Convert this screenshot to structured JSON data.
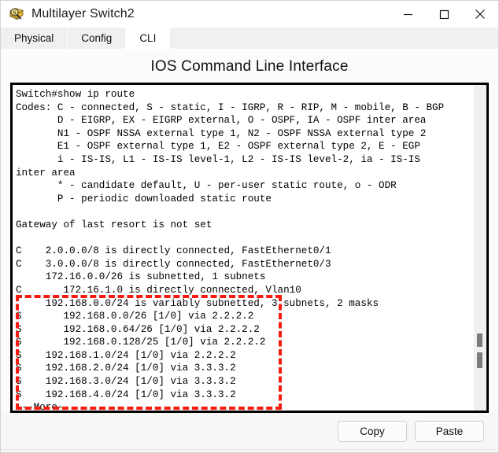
{
  "window": {
    "title": "Multilayer Switch2",
    "icon": "magnifier-over-package-icon",
    "controls": {
      "minimize": "minimize-icon",
      "maximize": "maximize-icon",
      "close": "close-icon"
    }
  },
  "tabs": [
    {
      "label": "Physical",
      "active": false
    },
    {
      "label": "Config",
      "active": false
    },
    {
      "label": "CLI",
      "active": true
    }
  ],
  "panel": {
    "title": "IOS Command Line Interface"
  },
  "terminal": {
    "lines": [
      "Switch#show ip route",
      "Codes: C - connected, S - static, I - IGRP, R - RIP, M - mobile, B - BGP",
      "       D - EIGRP, EX - EIGRP external, O - OSPF, IA - OSPF inter area",
      "       N1 - OSPF NSSA external type 1, N2 - OSPF NSSA external type 2",
      "       E1 - OSPF external type 1, E2 - OSPF external type 2, E - EGP",
      "       i - IS-IS, L1 - IS-IS level-1, L2 - IS-IS level-2, ia - IS-IS",
      "inter area",
      "       * - candidate default, U - per-user static route, o - ODR",
      "       P - periodic downloaded static route",
      "",
      "Gateway of last resort is not set",
      "",
      "C    2.0.0.0/8 is directly connected, FastEthernet0/1",
      "C    3.0.0.0/8 is directly connected, FastEthernet0/3",
      "     172.16.0.0/26 is subnetted, 1 subnets",
      "C       172.16.1.0 is directly connected, Vlan10",
      "     192.168.0.0/24 is variably subnetted, 3 subnets, 2 masks",
      "S       192.168.0.0/26 [1/0] via 2.2.2.2",
      "S       192.168.0.64/26 [1/0] via 2.2.2.2",
      "S       192.168.0.128/25 [1/0] via 2.2.2.2",
      "S    192.168.1.0/24 [1/0] via 2.2.2.2",
      "S    192.168.2.0/24 [1/0] via 3.3.3.2",
      "S    192.168.3.0/24 [1/0] via 3.3.3.2",
      "S    192.168.4.0/24 [1/0] via 3.3.3.2",
      " --More--"
    ],
    "annotation": {
      "color": "#f51b10",
      "style": "dashed-rectangle",
      "highlights_lines": [
        "192.168.0.0/24 is variably subnetted, 3 subnets, 2 masks",
        "S       192.168.0.0/26 [1/0] via 2.2.2.2",
        "S       192.168.0.64/26 [1/0] via 2.2.2.2",
        "S       192.168.0.128/25 [1/0] via 2.2.2.2",
        "S    192.168.1.0/24 [1/0] via 2.2.2.2",
        "S    192.168.2.0/24 [1/0] via 3.3.3.2",
        "S    192.168.3.0/24 [1/0] via 3.3.3.2",
        "S    192.168.4.0/24 [1/0] via 3.3.3.2"
      ]
    }
  },
  "footer": {
    "copy_label": "Copy",
    "paste_label": "Paste"
  }
}
